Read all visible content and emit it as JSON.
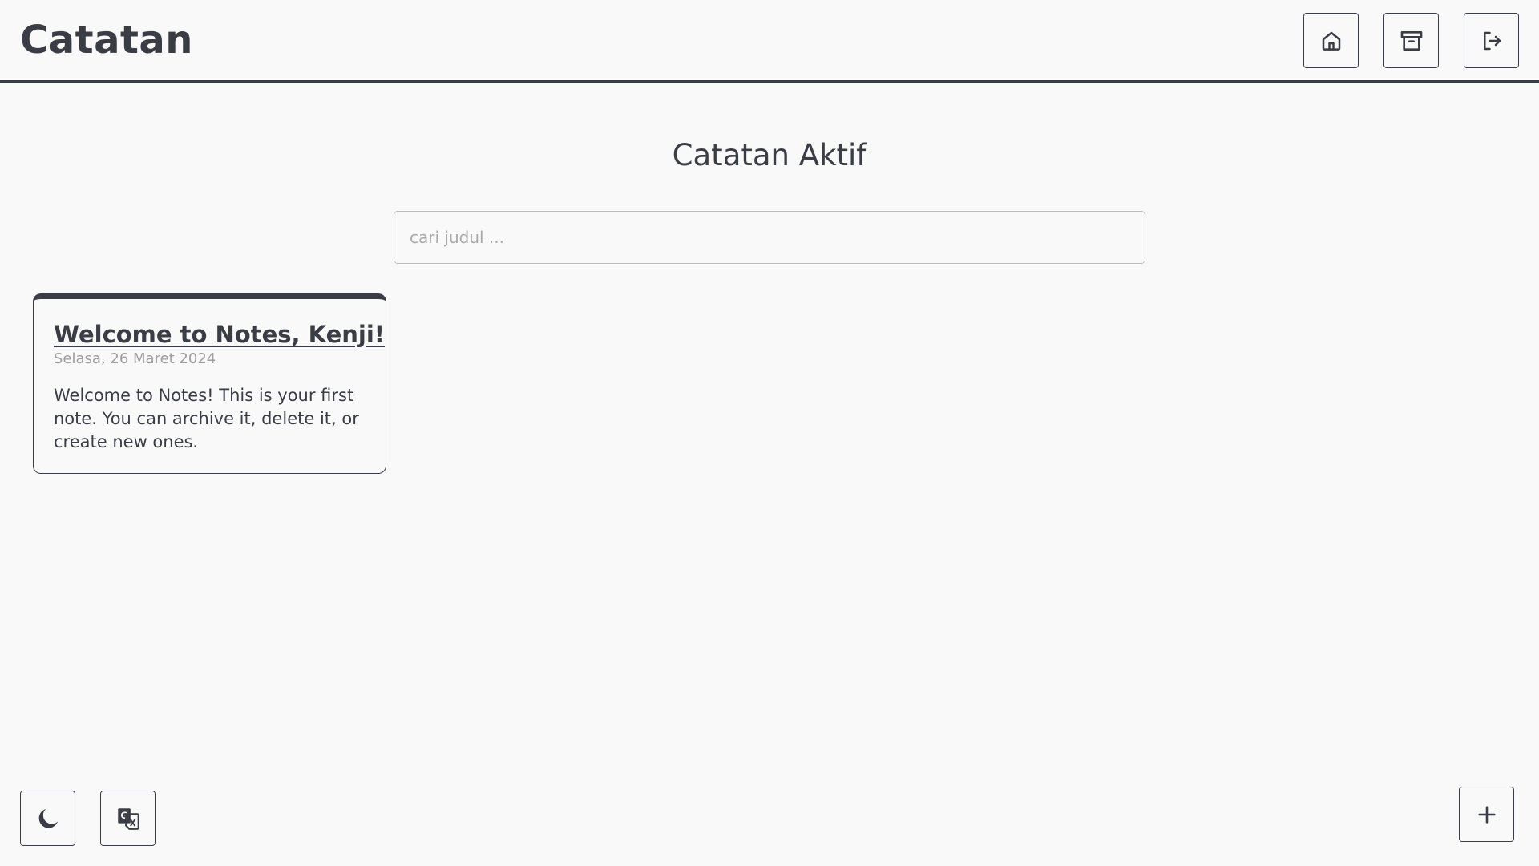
{
  "header": {
    "app_title": "Catatan",
    "nav_icons": [
      "home-icon",
      "archive-icon",
      "logout-icon"
    ]
  },
  "main": {
    "heading": "Catatan Aktif",
    "search": {
      "placeholder": "cari judul ...",
      "value": ""
    },
    "notes": [
      {
        "title": "Welcome to Notes, Kenji!",
        "date": "Selasa, 26 Maret 2024",
        "body": "Welcome to Notes! This is your first note. You can archive it, delete it, or create new ones."
      }
    ]
  },
  "footer": {
    "theme_toggle_icon": "moon-icon",
    "language_toggle_icon": "translate-icon",
    "add_note_icon": "plus-icon"
  },
  "colors": {
    "background": "#f9f9f9",
    "primary": "#3a3d44",
    "muted": "#9e9e9e"
  }
}
